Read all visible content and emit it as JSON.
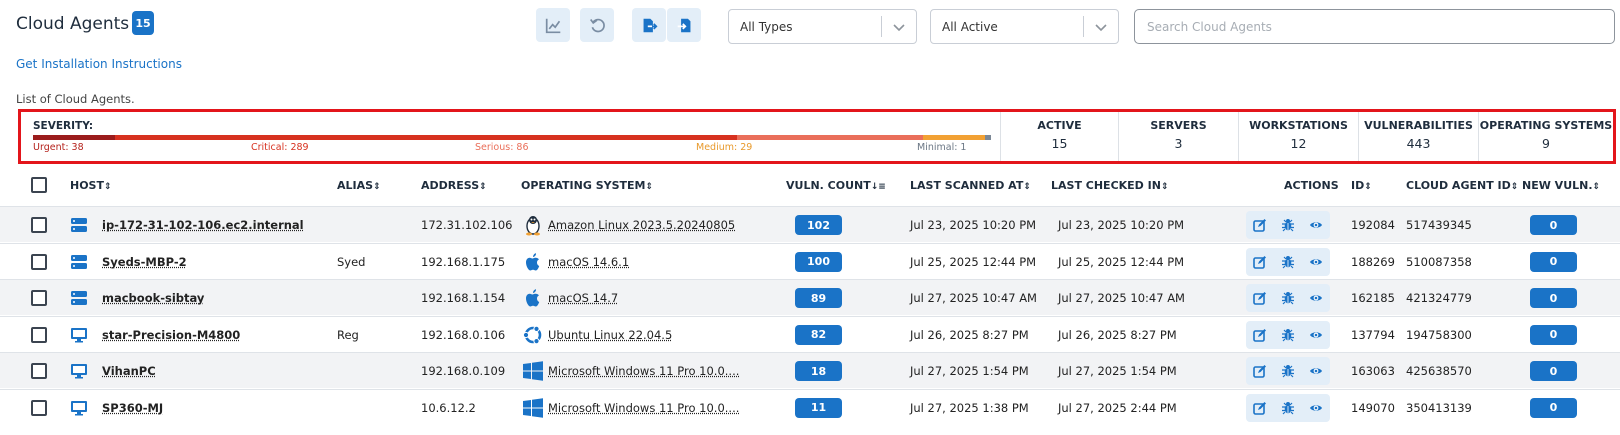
{
  "header": {
    "title": "Cloud Agents",
    "count": "15",
    "toolbar": [
      "chart-icon",
      "refresh-icon",
      "export-icon",
      "import-icon"
    ],
    "type_filter": "All Types",
    "status_filter": "All Active",
    "search_placeholder": "Search Cloud Agents",
    "install_link": "Get Installation Instructions",
    "subtitle": "List of Cloud Agents."
  },
  "summary": {
    "severity_label": "SEVERITY:",
    "severity": [
      {
        "label": "Urgent: 38",
        "value": 38,
        "color": "#9b1c1c"
      },
      {
        "label": "Critical: 289",
        "value": 289,
        "color": "#d7311f"
      },
      {
        "label": "Serious: 86",
        "value": 86,
        "color": "#ea6f5a"
      },
      {
        "label": "Medium: 29",
        "value": 29,
        "color": "#f2a133"
      },
      {
        "label": "Minimal: 1",
        "value": 1,
        "color": "#7c8896"
      }
    ],
    "stats": [
      {
        "label": "ACTIVE",
        "value": "15"
      },
      {
        "label": "SERVERS",
        "value": "3"
      },
      {
        "label": "WORKSTATIONS",
        "value": "12"
      },
      {
        "label": "VULNERABILITIES",
        "value": "443"
      },
      {
        "label": "OPERATING SYSTEMS",
        "value": "9"
      }
    ]
  },
  "table": {
    "columns": {
      "host": "HOST",
      "alias": "ALIAS",
      "address": "ADDRESS",
      "os": "OPERATING SYSTEM",
      "vuln": "VULN. COUNT",
      "scanned": "LAST SCANNED AT",
      "checked": "LAST CHECKED IN",
      "actions": "ACTIONS",
      "id": "ID",
      "agent_id": "CLOUD AGENT ID",
      "new_vuln": "NEW VULN."
    },
    "rows": [
      {
        "type": "server",
        "host": "ip-172-31-102-106.ec2.internal",
        "alias": "",
        "address": "172.31.102.106",
        "os_icon": "linux-icon",
        "os": "Amazon Linux 2023.5.20240805",
        "vuln": "102",
        "scanned": "Jul 23, 2025 10:20 PM",
        "checked": "Jul 23, 2025 10:20 PM",
        "id": "192084",
        "agent_id": "517439345",
        "new_vuln": "0"
      },
      {
        "type": "server",
        "host": "Syeds-MBP-2",
        "alias": "Syed",
        "address": "192.168.1.175",
        "os_icon": "apple-icon",
        "os": "macOS 14.6.1",
        "vuln": "100",
        "scanned": "Jul 25, 2025 12:44 PM",
        "checked": "Jul 25, 2025 12:44 PM",
        "id": "188269",
        "agent_id": "510087358",
        "new_vuln": "0"
      },
      {
        "type": "server",
        "host": "macbook-sibtay",
        "alias": "",
        "address": "192.168.1.154",
        "os_icon": "apple-icon",
        "os": "macOS 14.7",
        "vuln": "89",
        "scanned": "Jul 27, 2025 10:47 AM",
        "checked": "Jul 27, 2025 10:47 AM",
        "id": "162185",
        "agent_id": "421324779",
        "new_vuln": "0"
      },
      {
        "type": "workstation",
        "host": "star-Precision-M4800",
        "alias": "Reg",
        "address": "192.168.0.106",
        "os_icon": "ubuntu-icon",
        "os": "Ubuntu Linux 22.04.5",
        "vuln": "82",
        "scanned": "Jul 26, 2025 8:27 PM",
        "checked": "Jul 26, 2025 8:27 PM",
        "id": "137794",
        "agent_id": "194758300",
        "new_vuln": "0"
      },
      {
        "type": "workstation",
        "host": "VihanPC",
        "alias": "",
        "address": "192.168.0.109",
        "os_icon": "windows-icon",
        "os": "Microsoft Windows 11 Pro 10.0....",
        "vuln": "18",
        "scanned": "Jul 27, 2025 1:54 PM",
        "checked": "Jul 27, 2025 1:54 PM",
        "id": "163063",
        "agent_id": "425638570",
        "new_vuln": "0"
      },
      {
        "type": "workstation",
        "host": "SP360-MJ",
        "alias": "",
        "address": "10.6.12.2",
        "os_icon": "windows-icon",
        "os": "Microsoft Windows 11 Pro 10.0....",
        "vuln": "11",
        "scanned": "Jul 27, 2025 1:38 PM",
        "checked": "Jul 27, 2025 2:44 PM",
        "id": "149070",
        "agent_id": "350413139",
        "new_vuln": "0"
      }
    ]
  }
}
